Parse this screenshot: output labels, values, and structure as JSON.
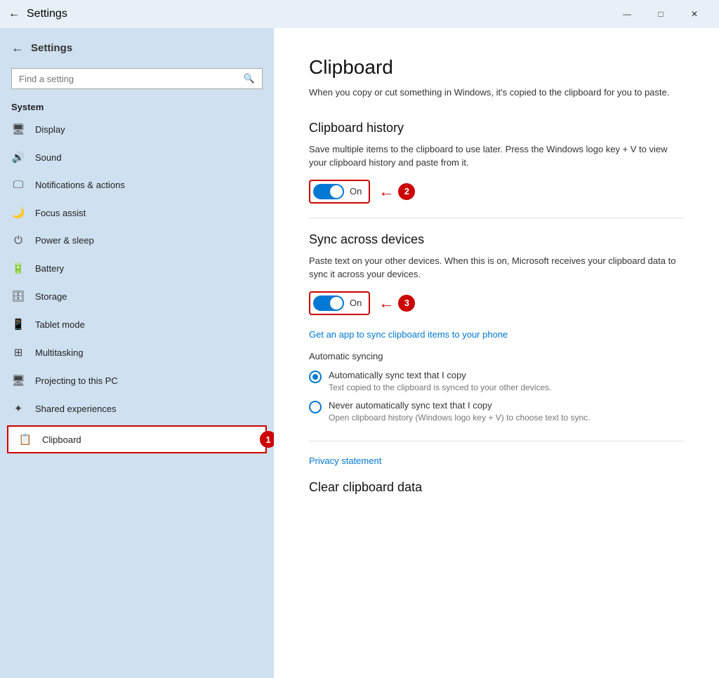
{
  "titleBar": {
    "title": "Settings",
    "minimize": "—",
    "restore": "□",
    "close": "✕"
  },
  "sidebar": {
    "backArrow": "←",
    "appTitle": "Settings",
    "search": {
      "placeholder": "Find a setting",
      "icon": "🔍"
    },
    "sectionLabel": "System",
    "navItems": [
      {
        "id": "display",
        "icon": "🖥",
        "label": "Display"
      },
      {
        "id": "sound",
        "icon": "🔊",
        "label": "Sound"
      },
      {
        "id": "notifications",
        "icon": "🖵",
        "label": "Notifications & actions"
      },
      {
        "id": "focus",
        "icon": "🌙",
        "label": "Focus assist"
      },
      {
        "id": "power",
        "icon": "⏻",
        "label": "Power & sleep"
      },
      {
        "id": "battery",
        "icon": "🔋",
        "label": "Battery"
      },
      {
        "id": "storage",
        "icon": "🗄",
        "label": "Storage"
      },
      {
        "id": "tablet",
        "icon": "📱",
        "label": "Tablet mode"
      },
      {
        "id": "multitasking",
        "icon": "⊞",
        "label": "Multitasking"
      },
      {
        "id": "projecting",
        "icon": "🖥",
        "label": "Projecting to this PC"
      },
      {
        "id": "shared",
        "icon": "✦",
        "label": "Shared experiences"
      },
      {
        "id": "clipboard",
        "icon": "📋",
        "label": "Clipboard",
        "active": true
      }
    ]
  },
  "main": {
    "title": "Clipboard",
    "subtitle": "When you copy or cut something in Windows, it's copied to the clipboard for you to paste.",
    "clipboardHistory": {
      "sectionTitle": "Clipboard history",
      "description": "Save multiple items to the clipboard to use later. Press the Windows logo key + V to view your clipboard history and paste from it.",
      "toggleState": "On"
    },
    "syncAcrossDevices": {
      "sectionTitle": "Sync across devices",
      "description": "Paste text on your other devices. When this is on, Microsoft receives your clipboard data to sync it across your devices.",
      "toggleState": "On",
      "link": "Get an app to sync clipboard items to your phone",
      "autoSyncLabel": "Automatic syncing",
      "radioOptions": [
        {
          "id": "auto-sync",
          "label": "Automatically sync text that I copy",
          "sublabel": "Text copied to the clipboard is synced to your other devices.",
          "selected": true
        },
        {
          "id": "never-sync",
          "label": "Never automatically sync text that I copy",
          "sublabel": "Open clipboard history (Windows logo key + V) to choose text to sync.",
          "selected": false
        }
      ]
    },
    "privacyLink": "Privacy statement",
    "clearSectionTitle": "Clear clipboard data"
  }
}
